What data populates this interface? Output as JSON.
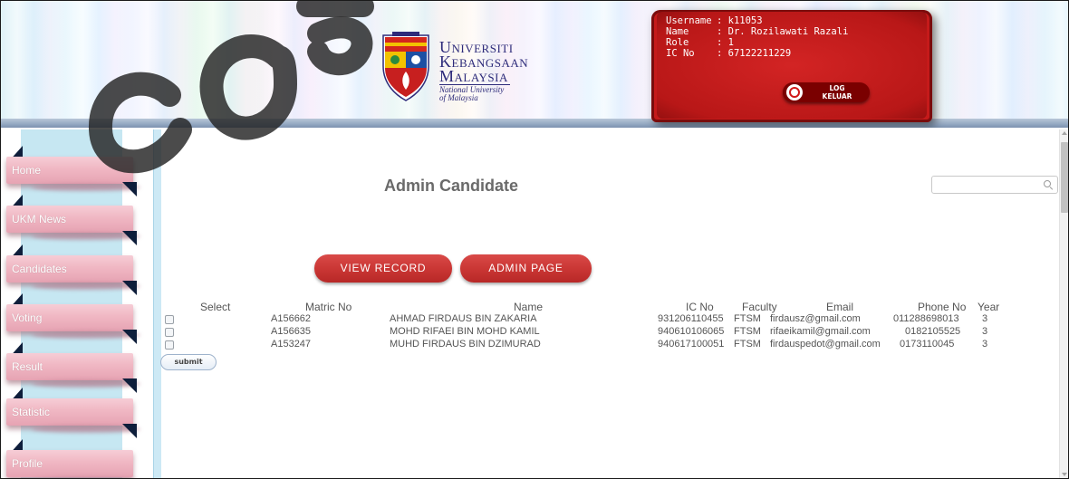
{
  "header": {
    "logo": {
      "line1_cap": "U",
      "line1_rest": "NIVERSITI",
      "line2_cap": "K",
      "line2_rest": "EBANGSAAN",
      "line3_cap": "M",
      "line3_rest": "ALAYSIA",
      "tagline_1": "National University",
      "tagline_2": "of Malaysia"
    },
    "user": {
      "username_label": "Username",
      "username_value": ": k11053",
      "name_label": "Name",
      "name_value": ": Dr. Rozilawati Razali",
      "role_label": "Role",
      "role_value": ": 1",
      "ic_label": "IC No",
      "ic_value": ": 67122211229"
    },
    "logout": {
      "line1": "LOG",
      "line2": "KELUAR"
    }
  },
  "sidebar": {
    "items": [
      {
        "label": "Home"
      },
      {
        "label": "UKM News"
      },
      {
        "label": "Candidates"
      },
      {
        "label": "Voting"
      },
      {
        "label": "Result"
      },
      {
        "label": "Statistic"
      },
      {
        "label": "Profile"
      }
    ]
  },
  "main": {
    "title": "Admin Candidate",
    "search_placeholder": "",
    "view_record_label": "VIEW RECORD",
    "admin_page_label": "ADMIN PAGE",
    "columns": [
      "Select",
      "Matric No",
      "Name",
      "IC No",
      "Faculty",
      "Email",
      "Phone No",
      "Year"
    ],
    "rows": [
      {
        "matric": "A156662",
        "name": "AHMAD FIRDAUS BIN ZAKARIA",
        "ic": "931206110455",
        "faculty": "FTSM",
        "email": "firdausz@gmail.com",
        "phone": "011288698013",
        "year": "3"
      },
      {
        "matric": "A156635",
        "name": "MOHD RIFAEI BIN MOHD KAMIL",
        "ic": "940610106065",
        "faculty": "FTSM",
        "email": "rifaeikamil@gmail.com",
        "phone": "0182105525",
        "year": "3"
      },
      {
        "matric": "A153247",
        "name": "MUHD FIRDAUS BIN DZIMURAD",
        "ic": "940617100051",
        "faculty": "FTSM",
        "email": "firdauspedot@gmail.com",
        "phone": "0173110045",
        "year": "3"
      }
    ],
    "submit_label": "submit"
  },
  "colors": {
    "accent_red": "#c93533",
    "panel_red": "#c51a1a",
    "sidebar_blue": "#c6e7f2",
    "nav_pink": "#f0b7c3",
    "nav_triangle": "#0e1e3b"
  },
  "icons": [
    "ukm-crest-icon",
    "logout-power-icon",
    "search-icon",
    "checkbox-icon",
    "scroll-up-arrow-icon",
    "scroll-down-arrow-icon"
  ]
}
